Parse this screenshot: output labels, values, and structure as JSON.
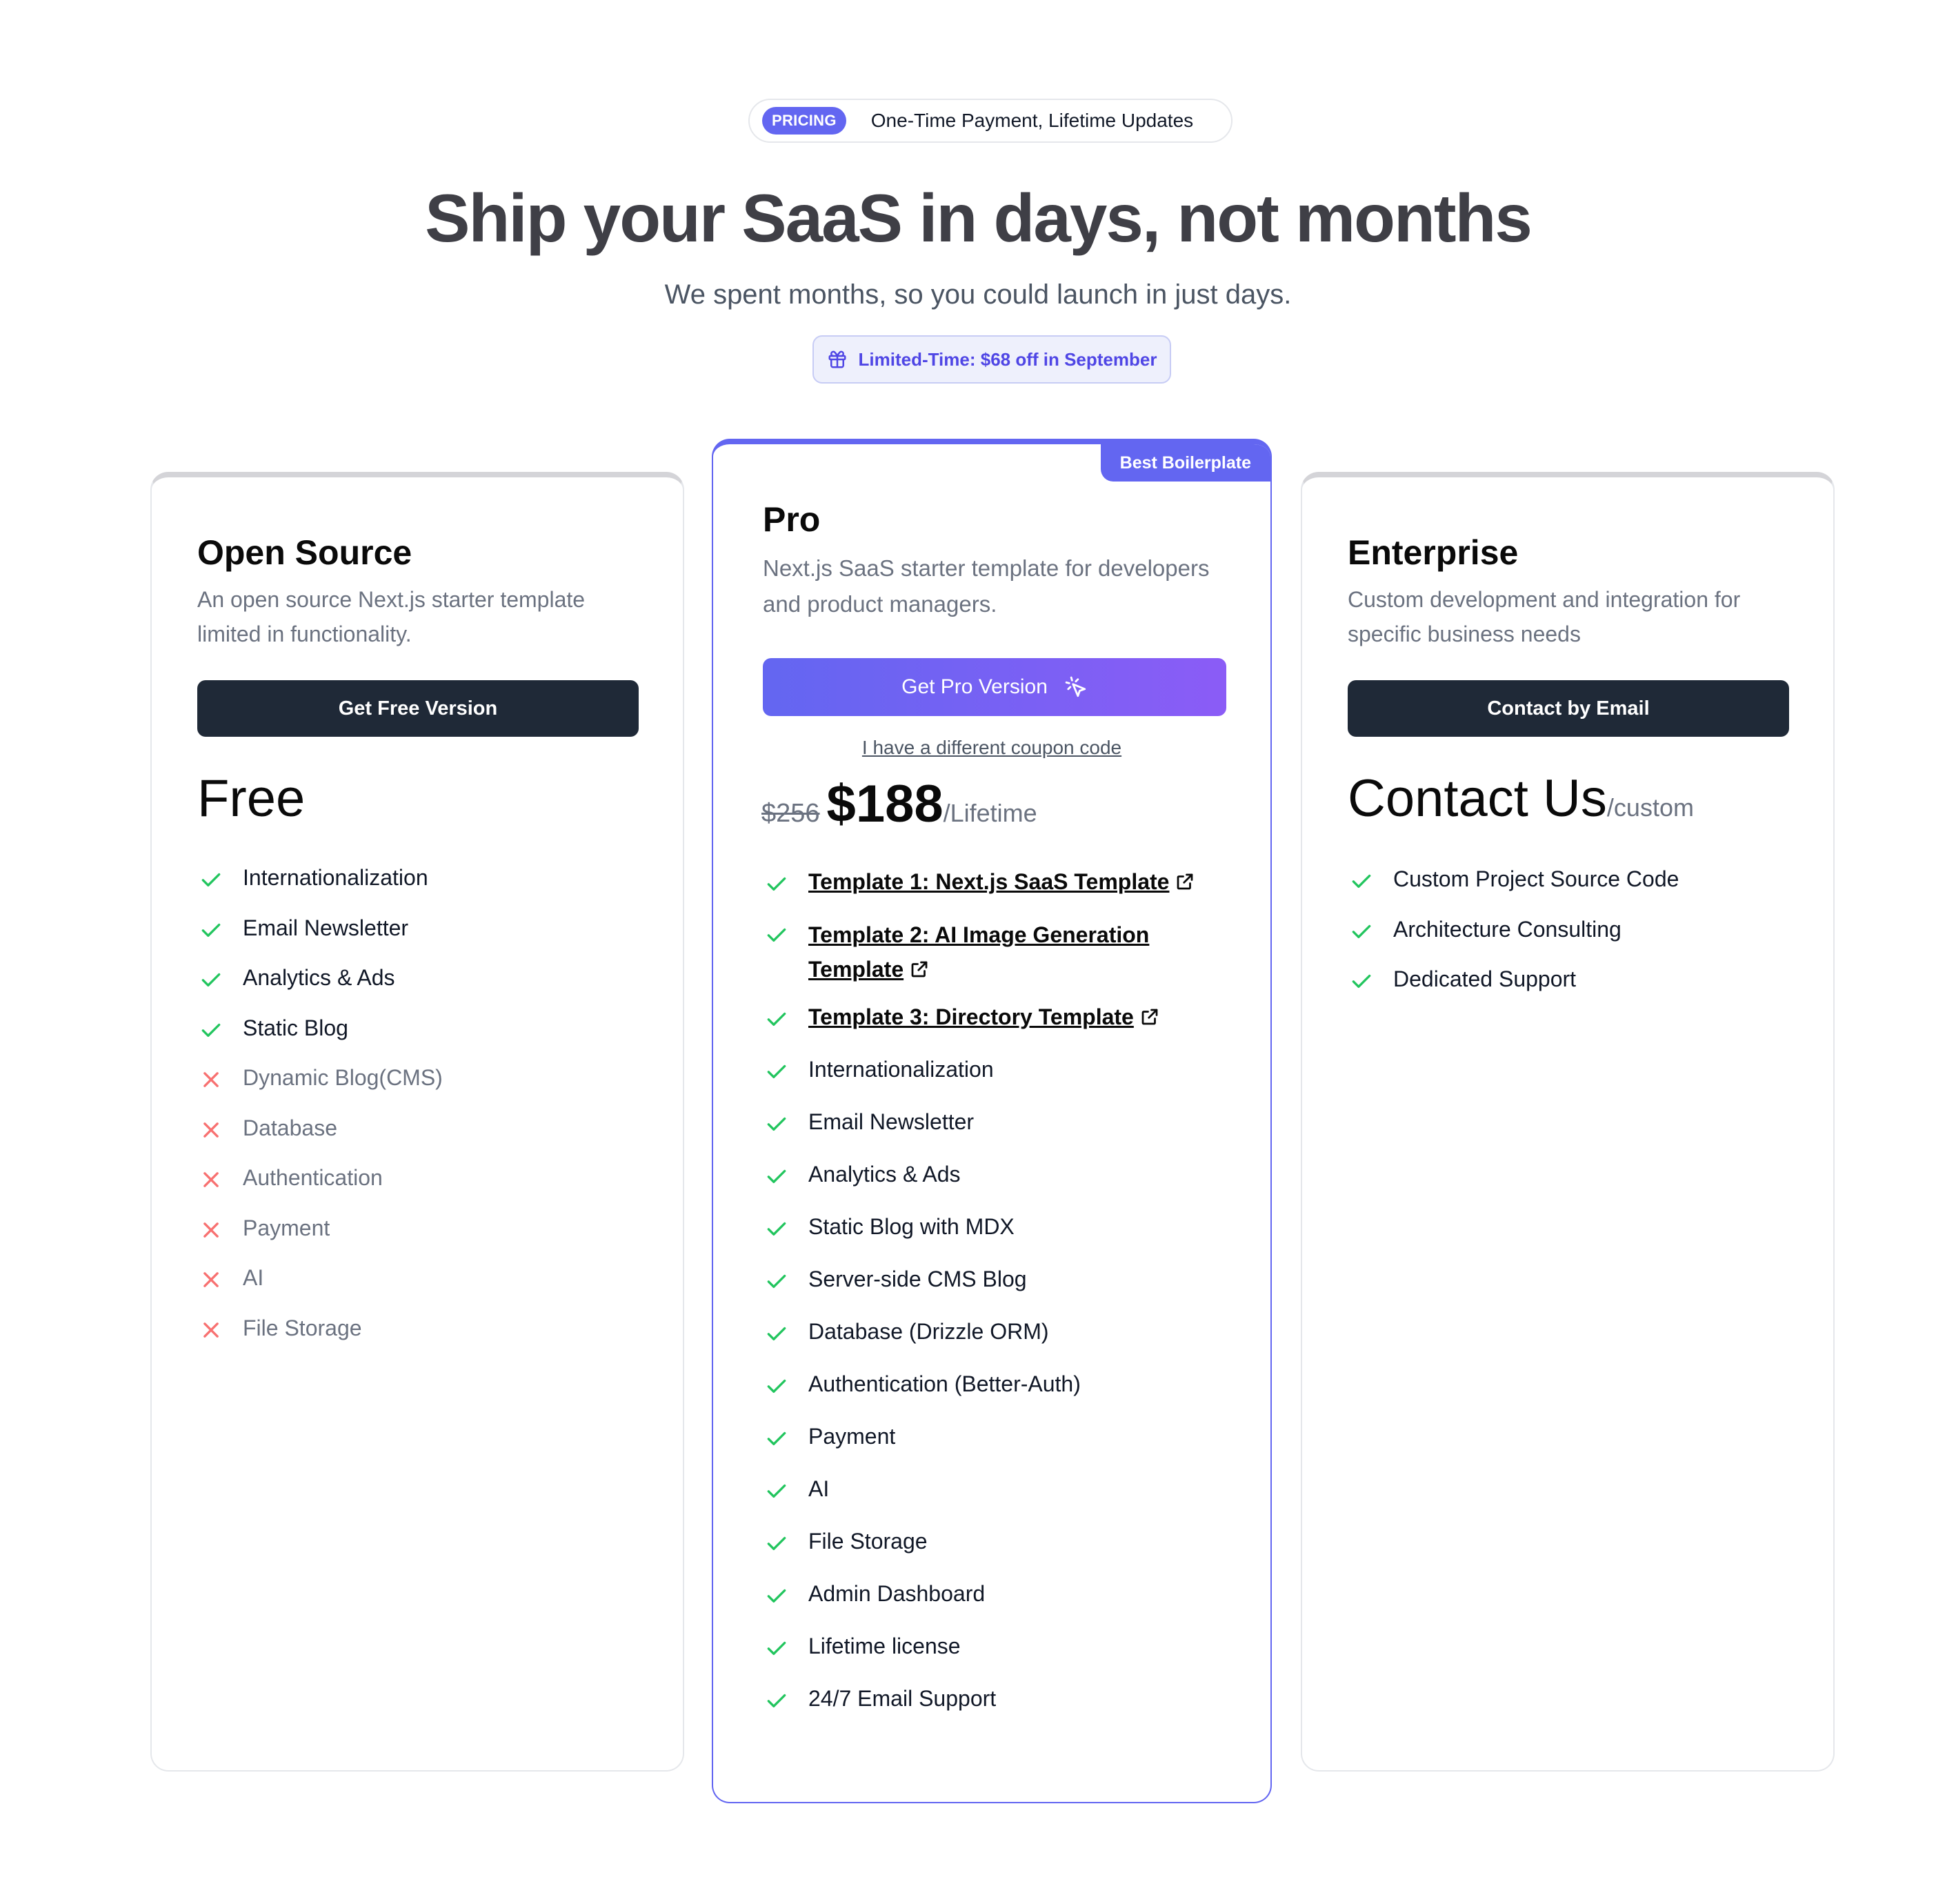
{
  "header": {
    "badge": "PRICING",
    "tagline": "One-Time Payment, Lifetime Updates",
    "title": "Ship your SaaS in days, not months",
    "subtitle": "We spent months, so you could launch in just days.",
    "promo": "Limited-Time: $68 off in September",
    "promo_icon": "gift-icon"
  },
  "colors": {
    "accent": "#6366f1",
    "accent_end": "#8b5cf6",
    "check": "#22c55e",
    "cross": "#f87171",
    "dark_button": "#1f2937"
  },
  "plans": {
    "free": {
      "title": "Open Source",
      "description": "An open source Next.js starter template limited in functionality.",
      "button": "Get Free Version",
      "price": "Free",
      "features": [
        {
          "label": "Internationalization",
          "included": true
        },
        {
          "label": "Email Newsletter",
          "included": true
        },
        {
          "label": "Analytics & Ads",
          "included": true
        },
        {
          "label": "Static Blog",
          "included": true
        },
        {
          "label": "Dynamic Blog(CMS)",
          "included": false
        },
        {
          "label": "Database",
          "included": false
        },
        {
          "label": "Authentication",
          "included": false
        },
        {
          "label": "Payment",
          "included": false
        },
        {
          "label": "AI",
          "included": false
        },
        {
          "label": "File Storage",
          "included": false
        }
      ]
    },
    "pro": {
      "ribbon": "Best Boilerplate",
      "title": "Pro",
      "description": "Next.js SaaS starter template for developers and product managers.",
      "button": "Get Pro Version",
      "button_icon": "sparkle-cursor-icon",
      "coupon": "I have a different coupon code",
      "original_price": "$256",
      "price": "$188",
      "price_unit": "/Lifetime",
      "templates": [
        "Template 1: Next.js SaaS Template",
        "Template 2: AI Image Generation Template",
        "Template 3: Directory Template"
      ],
      "features": [
        "Internationalization",
        "Email Newsletter",
        "Analytics & Ads",
        "Static Blog with MDX",
        "Server-side CMS Blog",
        "Database (Drizzle ORM)",
        "Authentication (Better-Auth)",
        "Payment",
        "AI",
        "File Storage",
        "Admin Dashboard",
        "Lifetime license",
        "24/7 Email Support"
      ]
    },
    "enterprise": {
      "title": "Enterprise",
      "description": "Custom development and integration for specific business needs",
      "button": "Contact by Email",
      "price": "Contact Us",
      "price_unit": "/custom",
      "features": [
        "Custom Project Source Code",
        "Architecture Consulting",
        "Dedicated Support"
      ]
    }
  }
}
